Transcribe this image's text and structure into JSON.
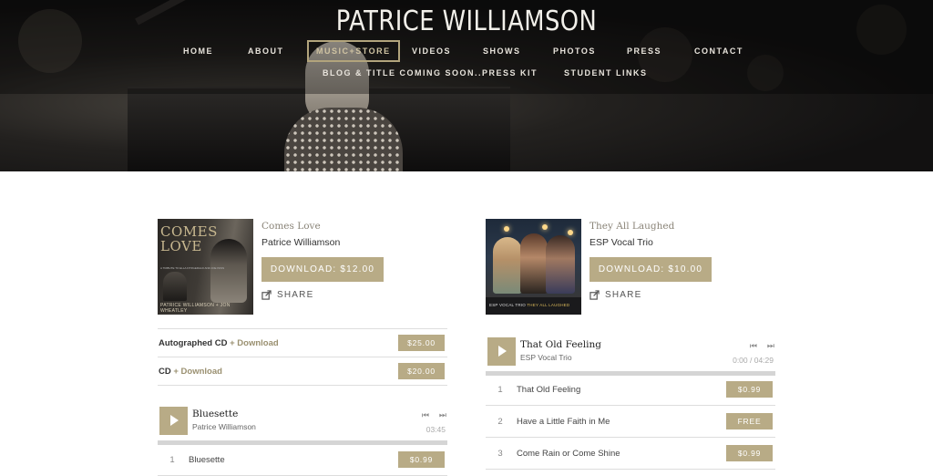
{
  "site": {
    "title": "PATRICE WILLIAMSON"
  },
  "nav": {
    "row1": [
      "HOME",
      "ABOUT",
      "MUSIC+STORE",
      "VIDEOS",
      "SHOWS",
      "PHOTOS",
      "PRESS",
      "CONTACT"
    ],
    "row2": [
      "BLOG & TITLE COMING SOON...",
      "PRESS KIT",
      "STUDENT LINKS"
    ],
    "active": "MUSIC+STORE"
  },
  "colors": {
    "accent": "#b8ab86",
    "hero_bg": "#141313"
  },
  "albums": [
    {
      "title": "Comes Love",
      "artist": "Patrice Williamson",
      "download_label": "DOWNLOAD: $12.00",
      "share_label": "SHARE",
      "cover": {
        "title_line1": "COMES",
        "title_line2": "LOVE",
        "subtitle": "A TRIBUTE TO ELLA FITZGERALD AND JOE PASS",
        "bottom": "PATRICE WILLIAMSON + JON WHEATLEY"
      },
      "options": [
        {
          "name": "Autographed CD",
          "extra": "+ Download",
          "price": "$25.00"
        },
        {
          "name": "CD",
          "extra": "+ Download",
          "price": "$20.00"
        }
      ],
      "player": {
        "track_title": "Bluesette",
        "track_artist": "Patrice Williamson",
        "time": "03:45",
        "progress": 0
      },
      "tracks": [
        {
          "num": "1",
          "name": "Bluesette",
          "price": "$0.99"
        }
      ]
    },
    {
      "title": "They All Laughed",
      "artist": "ESP Vocal Trio",
      "download_label": "DOWNLOAD: $10.00",
      "share_label": "SHARE",
      "cover": {
        "caption_a": "ESP VOCAL TRIO",
        "caption_b": "THEY ALL LAUGHED"
      },
      "player": {
        "track_title": "That Old Feeling",
        "track_artist": "ESP Vocal Trio",
        "time": "0:00 / 04:29",
        "progress": 0
      },
      "tracks": [
        {
          "num": "1",
          "name": "That Old Feeling",
          "price": "$0.99"
        },
        {
          "num": "2",
          "name": "Have a Little Faith in Me",
          "price": "FREE"
        },
        {
          "num": "3",
          "name": "Come Rain or Come Shine",
          "price": "$0.99"
        }
      ]
    }
  ],
  "icons": {
    "prev": "skip-back-icon",
    "next": "skip-forward-icon",
    "play": "play-icon",
    "share": "share-icon"
  }
}
